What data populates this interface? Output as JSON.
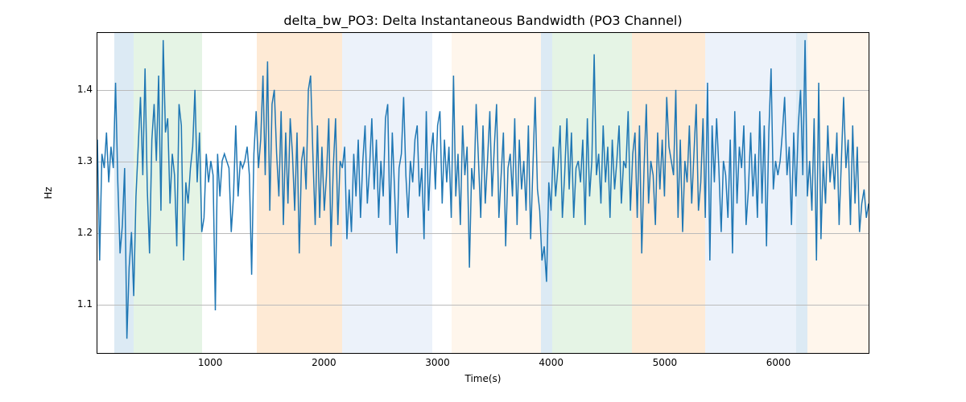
{
  "chart_data": {
    "type": "line",
    "title": "delta_bw_PO3: Delta Instantaneous Bandwidth (PO3 Channel)",
    "xlabel": "Time(s)",
    "ylabel": "Hz",
    "xlim": [
      0,
      6800
    ],
    "ylim": [
      1.03,
      1.48
    ],
    "xticks": [
      1000,
      2000,
      3000,
      4000,
      5000,
      6000
    ],
    "yticks": [
      1.1,
      1.2,
      1.3,
      1.4
    ],
    "grid": "horizontal",
    "bands": [
      {
        "x0": 150,
        "x1": 320,
        "color": "#9cc3e0"
      },
      {
        "x0": 320,
        "x1": 920,
        "color": "#b4e0b4"
      },
      {
        "x0": 1400,
        "x1": 2150,
        "color": "#fcc488"
      },
      {
        "x0": 2150,
        "x1": 2950,
        "color": "#c9daf0"
      },
      {
        "x0": 3120,
        "x1": 3900,
        "color": "#ffe6c9"
      },
      {
        "x0": 3900,
        "x1": 4000,
        "color": "#9cc3e0"
      },
      {
        "x0": 4000,
        "x1": 4700,
        "color": "#b4e0b4"
      },
      {
        "x0": 4700,
        "x1": 5350,
        "color": "#fcc488"
      },
      {
        "x0": 5350,
        "x1": 6150,
        "color": "#c9daf0"
      },
      {
        "x0": 6150,
        "x1": 6250,
        "color": "#9cc3e0"
      },
      {
        "x0": 6250,
        "x1": 6800,
        "color": "#ffe6c9"
      }
    ],
    "x": [
      0,
      20,
      40,
      60,
      80,
      100,
      120,
      140,
      160,
      180,
      200,
      220,
      240,
      260,
      280,
      300,
      320,
      340,
      360,
      380,
      400,
      420,
      440,
      460,
      480,
      500,
      520,
      540,
      560,
      580,
      600,
      620,
      640,
      660,
      680,
      700,
      720,
      740,
      760,
      780,
      800,
      820,
      840,
      860,
      880,
      900,
      920,
      940,
      960,
      980,
      1000,
      1020,
      1040,
      1060,
      1080,
      1100,
      1120,
      1140,
      1160,
      1180,
      1200,
      1220,
      1240,
      1260,
      1280,
      1300,
      1320,
      1340,
      1360,
      1380,
      1400,
      1420,
      1440,
      1460,
      1480,
      1500,
      1520,
      1540,
      1560,
      1580,
      1600,
      1620,
      1640,
      1660,
      1680,
      1700,
      1720,
      1740,
      1760,
      1780,
      1800,
      1820,
      1840,
      1860,
      1880,
      1900,
      1920,
      1940,
      1960,
      1980,
      2000,
      2020,
      2040,
      2060,
      2080,
      2100,
      2120,
      2140,
      2160,
      2180,
      2200,
      2220,
      2240,
      2260,
      2280,
      2300,
      2320,
      2340,
      2360,
      2380,
      2400,
      2420,
      2440,
      2460,
      2480,
      2500,
      2520,
      2540,
      2560,
      2580,
      2600,
      2620,
      2640,
      2660,
      2680,
      2700,
      2720,
      2740,
      2760,
      2780,
      2800,
      2820,
      2840,
      2860,
      2880,
      2900,
      2920,
      2940,
      2960,
      2980,
      3000,
      3020,
      3040,
      3060,
      3080,
      3100,
      3120,
      3140,
      3160,
      3180,
      3200,
      3220,
      3240,
      3260,
      3280,
      3300,
      3320,
      3340,
      3360,
      3380,
      3400,
      3420,
      3440,
      3460,
      3480,
      3500,
      3520,
      3540,
      3560,
      3580,
      3600,
      3620,
      3640,
      3660,
      3680,
      3700,
      3720,
      3740,
      3760,
      3780,
      3800,
      3820,
      3840,
      3860,
      3880,
      3900,
      3920,
      3940,
      3960,
      3980,
      4000,
      4020,
      4040,
      4060,
      4080,
      4100,
      4120,
      4140,
      4160,
      4180,
      4200,
      4220,
      4240,
      4260,
      4280,
      4300,
      4320,
      4340,
      4360,
      4380,
      4400,
      4420,
      4440,
      4460,
      4480,
      4500,
      4520,
      4540,
      4560,
      4580,
      4600,
      4620,
      4640,
      4660,
      4680,
      4700,
      4720,
      4740,
      4760,
      4780,
      4800,
      4820,
      4840,
      4860,
      4880,
      4900,
      4920,
      4940,
      4960,
      4980,
      5000,
      5020,
      5040,
      5060,
      5080,
      5100,
      5120,
      5140,
      5160,
      5180,
      5200,
      5220,
      5240,
      5260,
      5280,
      5300,
      5320,
      5340,
      5360,
      5380,
      5400,
      5420,
      5440,
      5460,
      5480,
      5500,
      5520,
      5540,
      5560,
      5580,
      5600,
      5620,
      5640,
      5660,
      5680,
      5700,
      5720,
      5740,
      5760,
      5780,
      5800,
      5820,
      5840,
      5860,
      5880,
      5900,
      5920,
      5940,
      5960,
      5980,
      6000,
      6020,
      6040,
      6060,
      6080,
      6100,
      6120,
      6140,
      6160,
      6180,
      6200,
      6220,
      6240,
      6260,
      6280,
      6300,
      6320,
      6340,
      6360,
      6380,
      6400,
      6420,
      6440,
      6460,
      6480,
      6500,
      6520,
      6540,
      6560,
      6580,
      6600,
      6620,
      6640,
      6660,
      6680,
      6700,
      6720,
      6740,
      6760,
      6780,
      6800
    ],
    "values": [
      1.33,
      1.16,
      1.31,
      1.29,
      1.34,
      1.27,
      1.32,
      1.29,
      1.41,
      1.27,
      1.17,
      1.21,
      1.29,
      1.05,
      1.15,
      1.2,
      1.11,
      1.25,
      1.32,
      1.39,
      1.28,
      1.43,
      1.26,
      1.17,
      1.33,
      1.38,
      1.3,
      1.42,
      1.23,
      1.47,
      1.34,
      1.36,
      1.24,
      1.31,
      1.28,
      1.18,
      1.38,
      1.35,
      1.16,
      1.27,
      1.24,
      1.29,
      1.32,
      1.4,
      1.27,
      1.34,
      1.2,
      1.22,
      1.31,
      1.27,
      1.3,
      1.28,
      1.09,
      1.31,
      1.25,
      1.3,
      1.31,
      1.3,
      1.29,
      1.2,
      1.25,
      1.35,
      1.25,
      1.3,
      1.29,
      1.3,
      1.32,
      1.28,
      1.14,
      1.31,
      1.37,
      1.29,
      1.33,
      1.42,
      1.28,
      1.44,
      1.23,
      1.38,
      1.4,
      1.31,
      1.25,
      1.37,
      1.21,
      1.34,
      1.24,
      1.36,
      1.31,
      1.23,
      1.34,
      1.17,
      1.3,
      1.32,
      1.26,
      1.4,
      1.42,
      1.31,
      1.21,
      1.35,
      1.22,
      1.32,
      1.23,
      1.28,
      1.36,
      1.18,
      1.29,
      1.36,
      1.21,
      1.3,
      1.29,
      1.32,
      1.19,
      1.26,
      1.2,
      1.31,
      1.25,
      1.33,
      1.22,
      1.3,
      1.35,
      1.24,
      1.29,
      1.36,
      1.26,
      1.33,
      1.22,
      1.3,
      1.25,
      1.36,
      1.38,
      1.21,
      1.34,
      1.26,
      1.17,
      1.29,
      1.31,
      1.39,
      1.28,
      1.22,
      1.3,
      1.27,
      1.33,
      1.35,
      1.25,
      1.29,
      1.19,
      1.37,
      1.23,
      1.31,
      1.34,
      1.26,
      1.35,
      1.37,
      1.24,
      1.33,
      1.27,
      1.32,
      1.22,
      1.42,
      1.25,
      1.31,
      1.21,
      1.35,
      1.28,
      1.32,
      1.15,
      1.29,
      1.26,
      1.38,
      1.3,
      1.22,
      1.35,
      1.24,
      1.3,
      1.37,
      1.25,
      1.32,
      1.38,
      1.22,
      1.28,
      1.34,
      1.18,
      1.29,
      1.31,
      1.25,
      1.36,
      1.21,
      1.33,
      1.26,
      1.3,
      1.23,
      1.35,
      1.19,
      1.29,
      1.39,
      1.26,
      1.23,
      1.16,
      1.18,
      1.13,
      1.27,
      1.23,
      1.32,
      1.25,
      1.29,
      1.35,
      1.22,
      1.28,
      1.36,
      1.26,
      1.34,
      1.22,
      1.29,
      1.3,
      1.27,
      1.33,
      1.21,
      1.36,
      1.25,
      1.3,
      1.45,
      1.28,
      1.31,
      1.24,
      1.35,
      1.27,
      1.32,
      1.22,
      1.33,
      1.26,
      1.3,
      1.35,
      1.24,
      1.3,
      1.29,
      1.37,
      1.23,
      1.31,
      1.34,
      1.22,
      1.35,
      1.17,
      1.29,
      1.38,
      1.24,
      1.3,
      1.28,
      1.21,
      1.34,
      1.26,
      1.33,
      1.25,
      1.39,
      1.32,
      1.3,
      1.28,
      1.4,
      1.22,
      1.33,
      1.2,
      1.3,
      1.27,
      1.35,
      1.24,
      1.31,
      1.38,
      1.23,
      1.27,
      1.36,
      1.22,
      1.41,
      1.16,
      1.35,
      1.27,
      1.36,
      1.29,
      1.2,
      1.3,
      1.28,
      1.22,
      1.33,
      1.17,
      1.37,
      1.24,
      1.32,
      1.29,
      1.35,
      1.21,
      1.26,
      1.34,
      1.25,
      1.31,
      1.22,
      1.37,
      1.24,
      1.35,
      1.18,
      1.34,
      1.43,
      1.26,
      1.3,
      1.28,
      1.3,
      1.34,
      1.39,
      1.28,
      1.32,
      1.21,
      1.34,
      1.25,
      1.35,
      1.4,
      1.28,
      1.47,
      1.25,
      1.3,
      1.23,
      1.36,
      1.16,
      1.41,
      1.19,
      1.3,
      1.24,
      1.35,
      1.27,
      1.31,
      1.26,
      1.34,
      1.21,
      1.3,
      1.39,
      1.29,
      1.33,
      1.21,
      1.35,
      1.24,
      1.32,
      1.2,
      1.24,
      1.26,
      1.22,
      1.24
    ]
  }
}
